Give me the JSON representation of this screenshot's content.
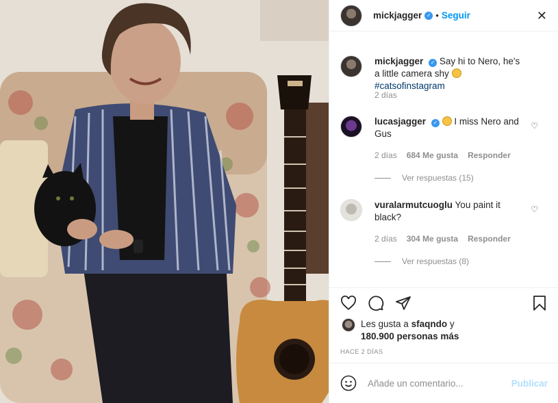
{
  "post": {
    "author": "mickjagger",
    "follow_label": "Seguir",
    "dot": "•",
    "caption_author": "mickjagger",
    "caption_text": "Say hi to Nero, he's a little camera shy",
    "caption_hashtag": "#catsofinstagram",
    "caption_time": "2 días"
  },
  "comments": [
    {
      "user": "lucasjagger",
      "text": "I miss Nero and Gus",
      "time": "2 días",
      "likes": "684 Me gusta",
      "reply_label": "Responder",
      "view_replies": "Ver respuestas (15)"
    },
    {
      "user": "vuralarmutcuoglu",
      "text": "You paint it black?",
      "time": "2 días",
      "likes": "304 Me gusta",
      "reply_label": "Responder",
      "view_replies": "Ver respuestas (8)"
    }
  ],
  "likes": {
    "prefix": "Les gusta a",
    "user": "sfaqndo",
    "suffix": "y",
    "count": "180.900 personas más"
  },
  "post_time": "HACE 2 DÍAS",
  "add_comment": {
    "placeholder": "Añade un comentario...",
    "publish_label": "Publicar"
  },
  "icons": {
    "verified": "verified-badge-icon",
    "heart": "heart-icon",
    "comment": "comment-icon",
    "share": "share-icon",
    "bookmark": "bookmark-icon",
    "smile": "emoji-icon",
    "close": "close-icon"
  },
  "colors": {
    "accent": "#0095f6",
    "verified": "#3897f0",
    "muted": "#8e8e8e",
    "publish_disabled": "#b2dffc"
  }
}
